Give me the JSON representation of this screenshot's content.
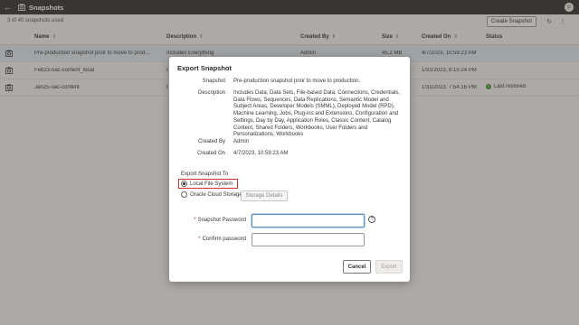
{
  "app": {
    "title": "Snapshots",
    "back_icon": "back-arrow-icon",
    "app_icon": "snapshot-icon",
    "avatar_icon": "user-avatar-icon"
  },
  "toolbar": {
    "count_text": "3 of 40 snapshots used",
    "create_label": "Create Snapshot",
    "refresh_icon": "refresh-icon",
    "more_icon": "more-vertical-icon"
  },
  "table": {
    "columns": [
      "Name",
      "Description",
      "Created By",
      "Size",
      "Created On",
      "Status"
    ],
    "rows": [
      {
        "name": "Pre-production snapshot prior to move to prod...",
        "description": "Includes Everything",
        "created_by": "Admin",
        "size": "45.2 MB",
        "created_on": "4/7/2023, 10:59:23 AM",
        "status": ""
      },
      {
        "name": "Feb23-oac-content_local",
        "description": "I",
        "created_by": "",
        "size": "",
        "created_on": "1/31/2023, 8:15:24 PM",
        "status": ""
      },
      {
        "name": "Jan25-oac-content",
        "description": "I",
        "created_by": "",
        "size": "",
        "created_on": "1/31/2023, 7:54:16 PM",
        "status": "Last restored"
      }
    ]
  },
  "dialog": {
    "title": "Export Snapshot",
    "fields": {
      "snapshot_label": "Snapshot",
      "snapshot_value": "Pre-production snapshot prior to move to production.",
      "description_label": "Description",
      "description_value": "Includes Data, Data Sets, File-based Data, Connections, Credentials, Data Flows, Sequences, Data Replications, Semantic Model and Subject Areas, Developer Models (SMML), Deployed Model (RPD), Machine Learning, Jobs, Plug-ins and Extensions, Configuration and Settings, Day by Day, Application Roles, Classic Content, Catalog Content, Shared Folders, Workbooks, User Folders and Personalizations, Workbooks",
      "created_by_label": "Created By",
      "created_by_value": "Admin",
      "created_on_label": "Created On",
      "created_on_value": "4/7/2023, 10:59:23 AM"
    },
    "export_to_label": "Export Snapshot To",
    "options": [
      "Local File System",
      "Oracle Cloud Storage"
    ],
    "selected_option": "Local File System",
    "storage_details_label": "Storage Details",
    "password_label": "Snapshot Password",
    "confirm_label": "Confirm password",
    "password_value": "",
    "confirm_value": "",
    "help_icon": "help-icon",
    "cancel_label": "Cancel",
    "export_label": "Export"
  },
  "colors": {
    "topbar": "#3a3631",
    "selected_row": "#dfe7ee",
    "highlight": "#d0312d",
    "success": "#4e8a3a"
  }
}
